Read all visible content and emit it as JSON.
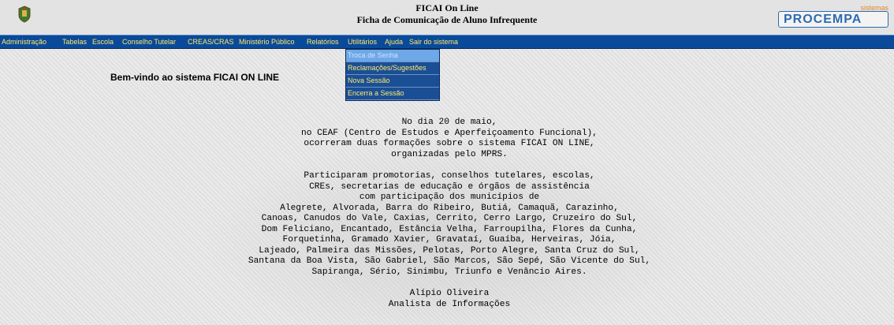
{
  "header": {
    "title": "FICAI On Line",
    "subtitle": "Ficha de Comunicação de Aluno Infrequente",
    "logo_top": "sistemas",
    "logo_main": "PROCEMPA"
  },
  "menu": {
    "items": [
      "Administração",
      "Tabelas",
      "Escola",
      "Conselho Tutelar",
      "CREAS/CRAS",
      "Ministério Público",
      "Relatórios",
      "Utilitários",
      "Ajuda",
      "Sair do sistema"
    ]
  },
  "dropdown": {
    "items": [
      "Troca de Senha",
      "Reclamações/Sugestões",
      "Nova Sessão",
      "Encerra a Sessão"
    ]
  },
  "welcome": "Bem-vindo ao sistema FICAI ON LINE",
  "paragraph1": [
    "No dia 20 de maio,",
    "no CEAF (Centro de Estudos e Aperfeiçoamento Funcional),",
    "ocorreram duas formações sobre o sistema FICAI ON LINE,",
    "organizadas pelo MPRS."
  ],
  "paragraph2": [
    "Participaram promotorias, conselhos tutelares, escolas,",
    "CREs, secretarias de educação e órgãos de assistência",
    "com participação dos municípios de",
    "Alegrete, Alvorada, Barra do Ribeiro, Butiá, Camaquã, Carazinho,",
    "Canoas, Canudos do Vale, Caxias, Cerrito, Cerro Largo, Cruzeiro do Sul,",
    "Dom Feliciano, Encantado, Estância Velha, Farroupilha, Flores da Cunha,",
    "Forquetinha, Gramado Xavier, Gravataí, Guaíba, Herveiras, Jóia,",
    "Lajeado, Palmeira das Missões, Pelotas, Porto Alegre, Santa Cruz do Sul,",
    "Santana da Boa Vista, São Gabriel, São Marcos, São Sepé, São Vicente do Sul,",
    "Sapiranga, Sério, Sinimbu, Triunfo e Venâncio Aires."
  ],
  "signature": {
    "name": "Alípio Oliveira",
    "role": "Analista de Informações"
  },
  "icons": {
    "crest": "state-crest-icon"
  },
  "colors": {
    "menu_bg": "#0a4a9a",
    "menu_text": "#ffe86b",
    "dropdown_active": "#6da8e8",
    "logo_blue": "#2f6bb0"
  }
}
